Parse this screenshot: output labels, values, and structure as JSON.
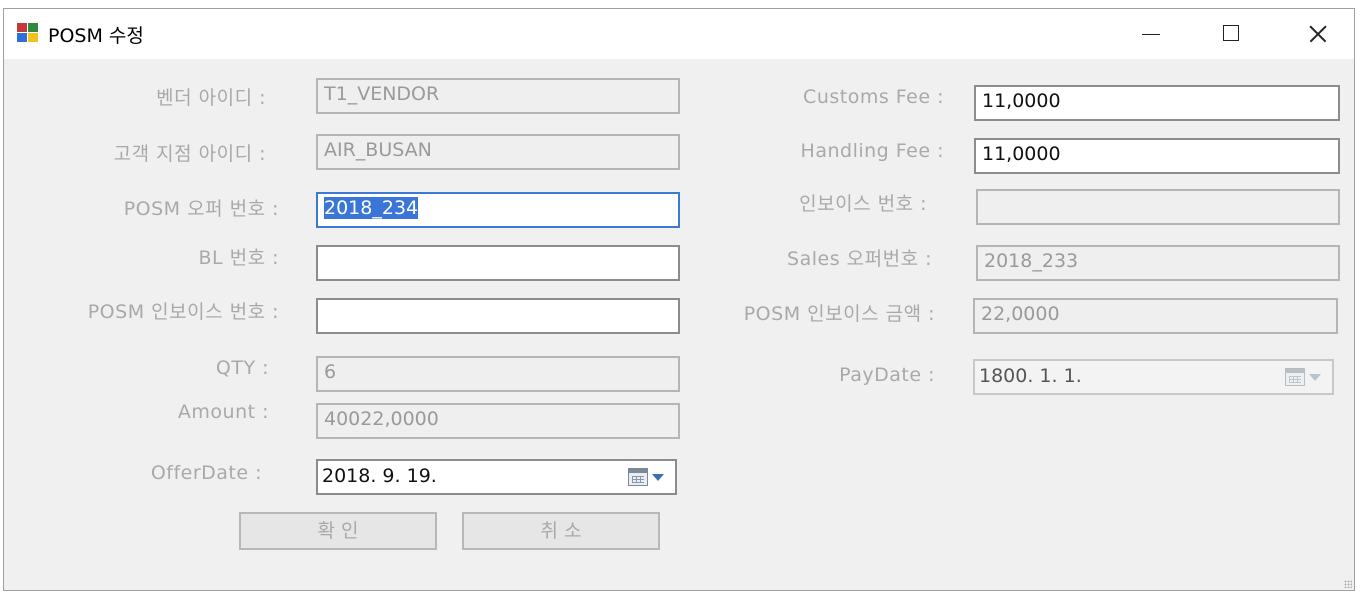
{
  "window": {
    "title": "POSM 수정"
  },
  "left": {
    "vendor_id_label": "벤더 아이디 :",
    "vendor_id_value": "T1_VENDOR",
    "customer_branch_label": "고객 지점 아이디 :",
    "customer_branch_value": "AIR_BUSAN",
    "posm_offer_label": "POSM 오퍼 번호 :",
    "posm_offer_value": "2018_234",
    "bl_label": "BL 번호 :",
    "bl_value": "",
    "posm_invoice_no_label": "POSM 인보이스 번호 :",
    "posm_invoice_no_value": "",
    "qty_label": "QTY :",
    "qty_value": "6",
    "amount_label": "Amount :",
    "amount_value": "40022,0000",
    "offer_date_label": "OfferDate :",
    "offer_date_value": "2018.   9.  19."
  },
  "right": {
    "customs_fee_label": "Customs Fee :",
    "customs_fee_value": "11,0000",
    "handling_fee_label": "Handling Fee :",
    "handling_fee_value": "11,0000",
    "invoice_no_label": "인보이스 번호 :",
    "invoice_no_value": "",
    "sales_offer_label": "Sales 오퍼번호 :",
    "sales_offer_value": "2018_233",
    "posm_invoice_amount_label": "POSM 인보이스 금액 :",
    "posm_invoice_amount_value": "22,0000",
    "pay_date_label": "PayDate :",
    "pay_date_value": "1800.    1.    1."
  },
  "buttons": {
    "confirm": "확 인",
    "cancel": "취 소"
  },
  "icons": {
    "app": "app-icon",
    "calendar": "calendar-icon",
    "dropdown": "chevron-down-icon"
  },
  "colors": {
    "focus_border": "#3d7ad6",
    "selection": "#3a75d8",
    "disabled_text": "#a9a9a9"
  }
}
